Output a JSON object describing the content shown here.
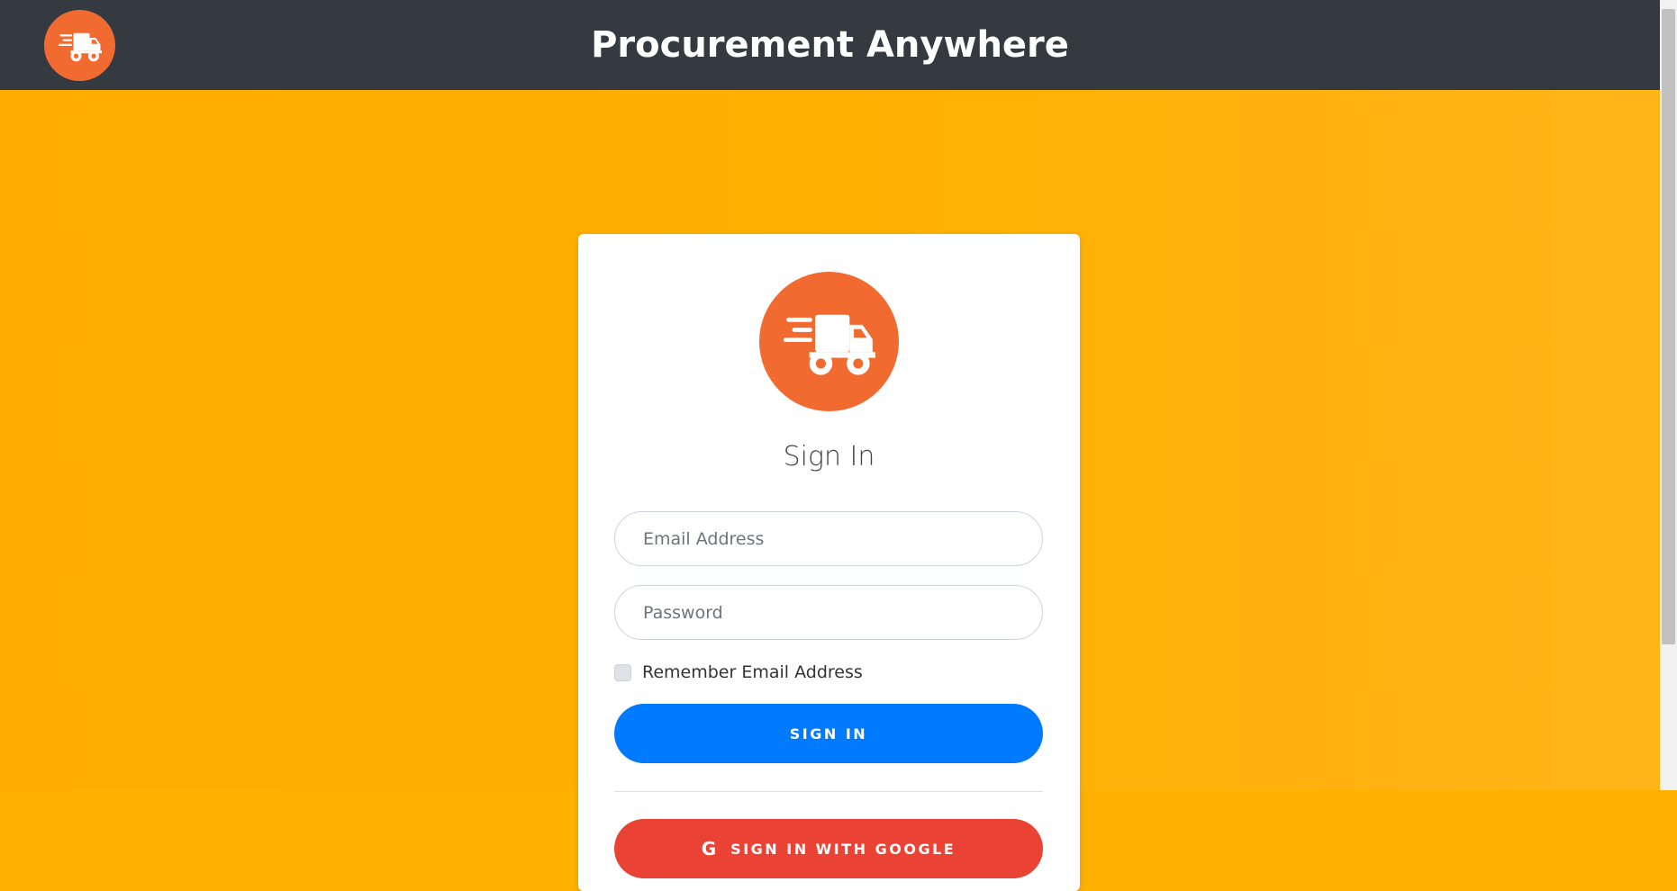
{
  "header": {
    "title": "Procurement Anywhere",
    "logo_icon": "truck-icon"
  },
  "login": {
    "logo_icon": "truck-icon",
    "title": "Sign In",
    "email_placeholder": "Email Address",
    "password_placeholder": "Password",
    "remember_label": "Remember Email Address",
    "remember_checked": false,
    "signin_button": "SIGN IN",
    "google_button": "SIGN IN WITH GOOGLE",
    "google_icon_glyph": "G",
    "google_icon": "google-icon"
  },
  "colors": {
    "header_bg": "#343a40",
    "page_bg": "#ffb000",
    "logo_bg": "#f16a30",
    "signin_button": "#007bff",
    "google_button": "#ea4335"
  }
}
